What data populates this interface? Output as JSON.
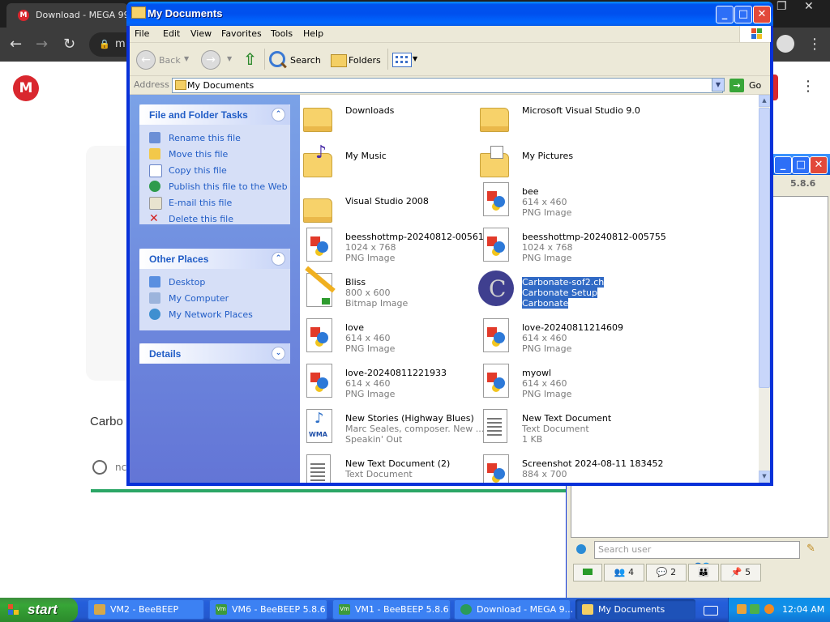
{
  "browser": {
    "tab_title": "Download - MEGA 99%",
    "tab_favicon_letter": "M",
    "omnibox_text": "m",
    "mega_logo_letter": "M",
    "file_name_partial": "Carbo",
    "status_text_partial": "nc",
    "progress_percent": 99
  },
  "beebeep": {
    "version": "5.8.6",
    "search_placeholder": "Search user",
    "tabs": [
      "4",
      "2",
      "",
      "5"
    ]
  },
  "explorer": {
    "title": "My Documents",
    "menu": [
      "File",
      "Edit",
      "View",
      "Favorites",
      "Tools",
      "Help"
    ],
    "toolbar": {
      "back": "Back",
      "search": "Search",
      "folders": "Folders"
    },
    "address_label": "Address",
    "address_value": "My Documents",
    "go_label": "Go",
    "tasks": {
      "file_folder": {
        "title": "File and Folder Tasks",
        "items": [
          "Rename this file",
          "Move this file",
          "Copy this file",
          "Publish this file to the Web",
          "E-mail this file",
          "Delete this file"
        ]
      },
      "other_places": {
        "title": "Other Places",
        "items": [
          "Desktop",
          "My Computer",
          "My Network Places"
        ]
      },
      "details": {
        "title": "Details"
      }
    },
    "files": [
      {
        "name": "Downloads",
        "line1": "",
        "line2": "",
        "icon": "folder"
      },
      {
        "name": "Microsoft Visual Studio 9.0",
        "line1": "",
        "line2": "",
        "icon": "folder"
      },
      {
        "name": "My Music",
        "line1": "",
        "line2": "",
        "icon": "music-folder"
      },
      {
        "name": "My Pictures",
        "line1": "",
        "line2": "",
        "icon": "pictures-folder"
      },
      {
        "name": "Visual Studio 2008",
        "line1": "",
        "line2": "",
        "icon": "folder"
      },
      {
        "name": "bee",
        "line1": "614 x 460",
        "line2": "PNG Image",
        "icon": "png"
      },
      {
        "name": "beesshottmp-20240812-005614",
        "line1": "1024 x 768",
        "line2": "PNG Image",
        "icon": "png"
      },
      {
        "name": "beesshottmp-20240812-005755",
        "line1": "1024 x 768",
        "line2": "PNG Image",
        "icon": "png"
      },
      {
        "name": "Bliss",
        "line1": "800 x 600",
        "line2": "Bitmap Image",
        "icon": "bmp"
      },
      {
        "name": "Carbonate-sof2.ch",
        "line1": "Carbonate Setup",
        "line2": "Carbonate",
        "icon": "carbonate",
        "selected": true
      },
      {
        "name": "love",
        "line1": "614 x 460",
        "line2": "PNG Image",
        "icon": "png"
      },
      {
        "name": "love-20240811214609",
        "line1": "614 x 460",
        "line2": "PNG Image",
        "icon": "png"
      },
      {
        "name": "love-20240811221933",
        "line1": "614 x 460",
        "line2": "PNG Image",
        "icon": "png"
      },
      {
        "name": "myowl",
        "line1": "614 x 460",
        "line2": "PNG Image",
        "icon": "png"
      },
      {
        "name": "New Stories (Highway Blues)",
        "line1": "Marc Seales, composer. New ...",
        "line2": "Speakin' Out",
        "icon": "wma"
      },
      {
        "name": "New Text Document",
        "line1": "Text Document",
        "line2": "1 KB",
        "icon": "txt"
      },
      {
        "name": "New Text Document (2)",
        "line1": "Text Document",
        "line2": "",
        "icon": "txt"
      },
      {
        "name": "Screenshot 2024-08-11 183452",
        "line1": "884 x 700",
        "line2": "",
        "icon": "png"
      }
    ]
  },
  "taskbar": {
    "start_label": "start",
    "tasks": [
      {
        "label": "VM2 - BeeBEEP",
        "active": false
      },
      {
        "label": "VM6 - BeeBEEP 5.8.6",
        "active": false
      },
      {
        "label": "VM1 - BeeBEEP 5.8.6",
        "active": false
      },
      {
        "label": "Download - MEGA 9...",
        "active": false
      },
      {
        "label": "My Documents",
        "active": true
      }
    ],
    "clock": "12:04 AM"
  },
  "colors": {
    "xp_blue": "#0831d9",
    "selection": "#316ac5",
    "task_link": "#215dc6",
    "mega_red": "#d9272e",
    "progress_green": "#2ba666"
  }
}
